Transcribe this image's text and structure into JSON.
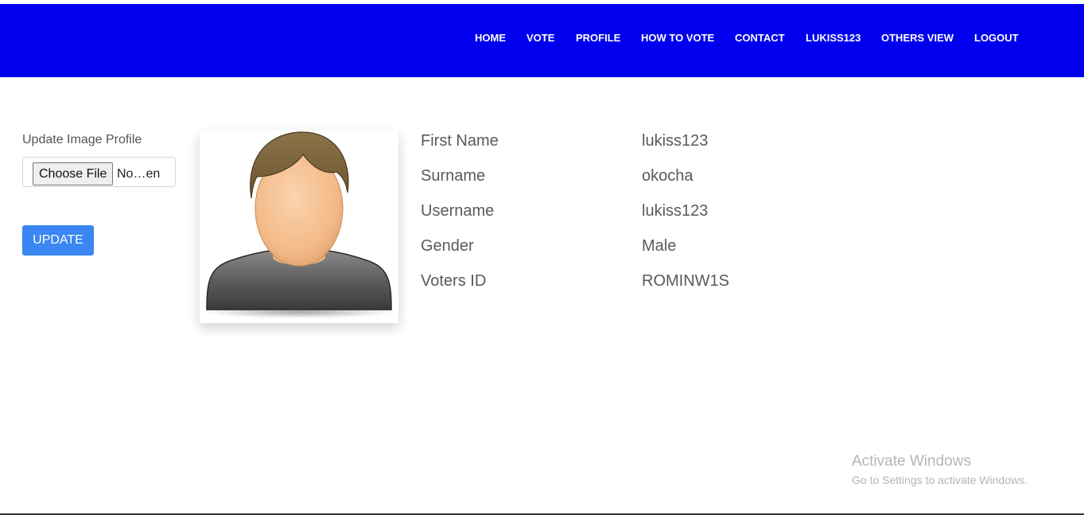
{
  "nav": {
    "items": [
      "HOME",
      "VOTE",
      "PROFILE",
      "HOW TO VOTE",
      "CONTACT",
      "LUKISS123",
      "OTHERS VIEW",
      "LOGOUT"
    ]
  },
  "upload": {
    "label": "Update Image Profile",
    "choose_label": "Choose File",
    "file_status": "No…en",
    "update_label": "UPDATE"
  },
  "avatar": {
    "icon": "user-avatar-icon"
  },
  "profile": {
    "fields": [
      {
        "label": "First Name",
        "value": "lukiss123"
      },
      {
        "label": "Surname",
        "value": "okocha"
      },
      {
        "label": "Username",
        "value": "lukiss123"
      },
      {
        "label": "Gender",
        "value": "Male"
      },
      {
        "label": "Voters ID",
        "value": "ROMINW1S"
      }
    ]
  },
  "watermark": {
    "title": "Activate Windows",
    "subtitle": "Go to Settings to activate Windows."
  },
  "colors": {
    "navbar": "#0000ee",
    "update_button": "#3a86f2",
    "text": "#5a5a5a"
  }
}
